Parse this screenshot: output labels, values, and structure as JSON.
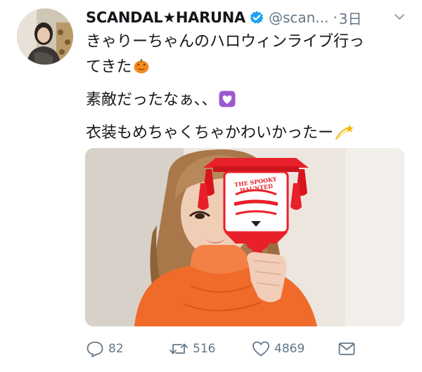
{
  "tweet": {
    "author": {
      "name": "SCANDAL★HARUNA",
      "handle": "@scan...",
      "verified": true
    },
    "separator": "·",
    "time": "3日",
    "text": {
      "line1": "きゃりーちゃんのハロウィンライブ行っ",
      "line2": "てきた",
      "line3": "素敵だったなぁ、、",
      "line4": "衣装もめちゃくちゃかわいかったー"
    },
    "emoji": [
      "jack-o-lantern",
      "purple-heart",
      "dizzy"
    ],
    "photo": {
      "lantern_text": "THE SPOOKY HAUNTED"
    },
    "actions": {
      "replies": "82",
      "retweets": "516",
      "likes": "4869"
    },
    "colors": {
      "text": "#14171a",
      "secondary": "#657786",
      "verified": "#1da1f2",
      "orange": "#f06a2a",
      "lantern_red": "#e8202a"
    }
  }
}
